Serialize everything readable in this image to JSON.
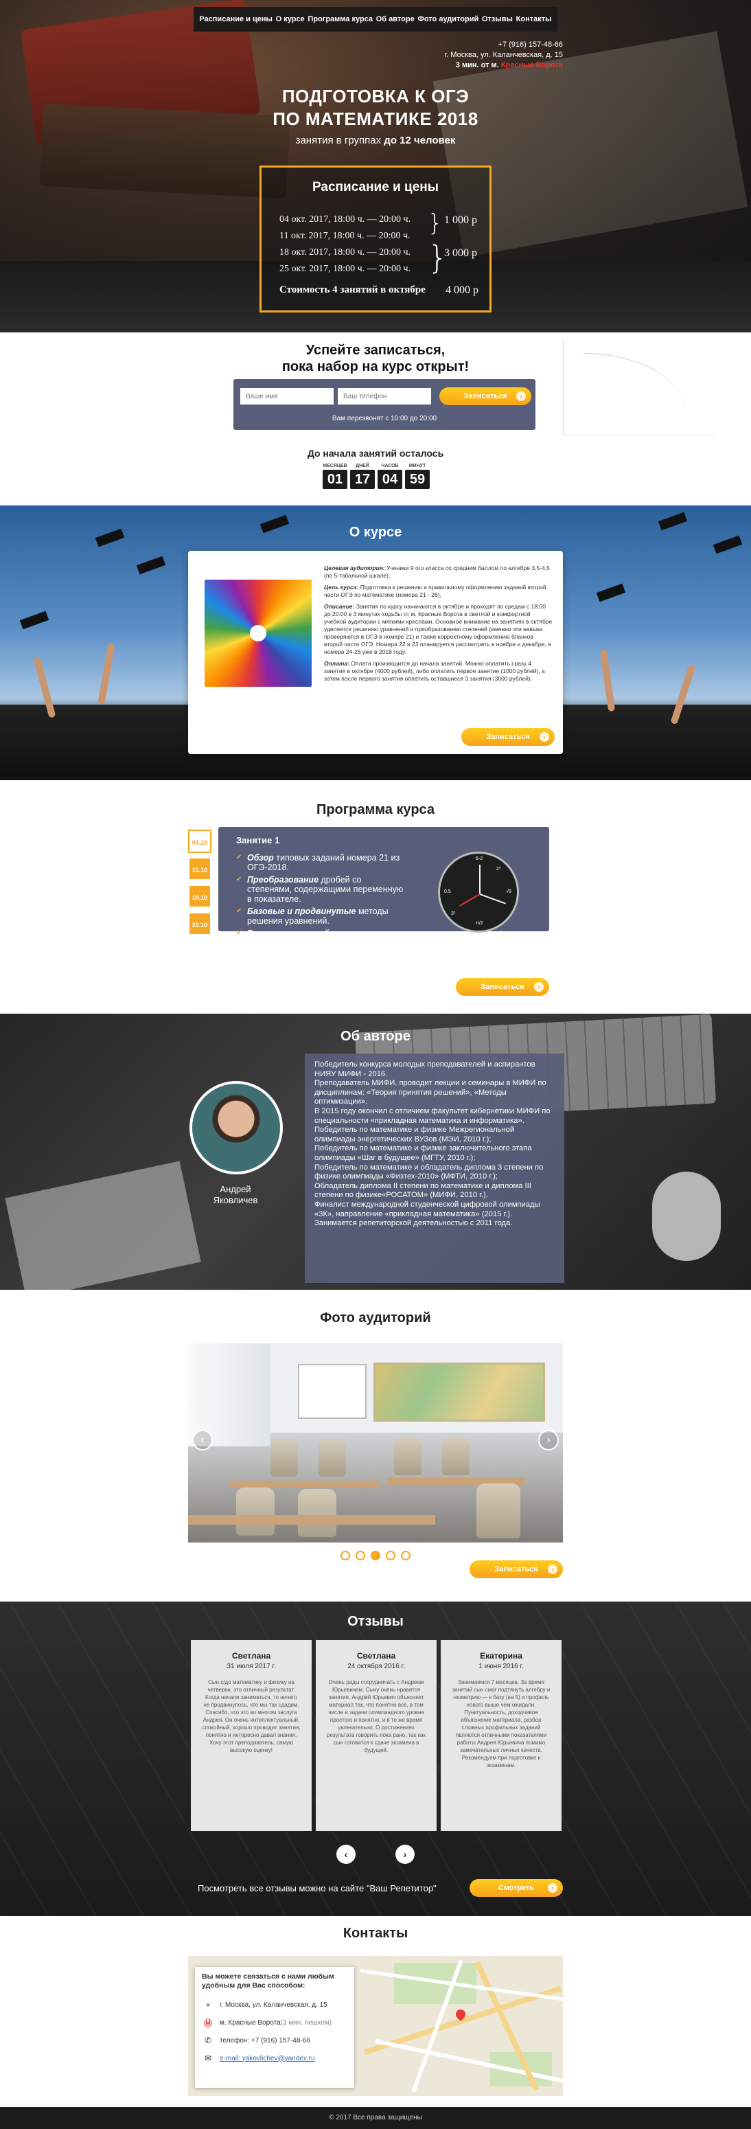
{
  "nav": {
    "items": [
      "Расписание и цены",
      "О курсе",
      "Программа курса",
      "Об авторе",
      "Фото аудиторий",
      "Отзывы",
      "Контакты"
    ]
  },
  "contact_top": {
    "phone": "+7 (916) 157-48-66",
    "address": "г. Москва, ул. Каланчевская, д. 15",
    "walk": "3 мин. от м.",
    "metro": "Красные Ворота"
  },
  "hero": {
    "title_line1": "ПОДГОТОВКА К ОГЭ",
    "title_line2": "ПО МАТЕМАТИКЕ 2018",
    "subtitle_prefix": "занятия в группах",
    "subtitle_bold": "до 12 человек"
  },
  "schedule": {
    "title": "Расписание и цены",
    "rows": [
      "04 окт. 2017, 18:00 ч. — 20:00 ч.",
      "11 окт. 2017, 18:00 ч. — 20:00 ч.",
      "18 окт. 2017, 18:00 ч. — 20:00 ч.",
      "25 окт. 2017, 18:00 ч. — 20:00 ч."
    ],
    "price1": "1 000 р",
    "price2": "3 000 р",
    "total_label": "Стоимость 4 занятий в октябре",
    "total_price": "4 000 р"
  },
  "signup": {
    "title_line1": "Успейте записаться,",
    "title_line2": "пока набор на курс открыт!",
    "name_placeholder": "Ваше имя",
    "phone_placeholder": "Ваш телефон",
    "button": "Записаться",
    "callback": "Вам перезвонят с 10:00 до 20:00",
    "countdown_title": "До начала занятий осталось",
    "countdown": [
      {
        "label": "МЕСЯЦЕВ",
        "value": "01"
      },
      {
        "label": "ДНЕЙ",
        "value": "17"
      },
      {
        "label": "ЧАСОВ",
        "value": "04"
      },
      {
        "label": "МИНУТ",
        "value": "59"
      }
    ]
  },
  "about": {
    "title": "О курсе",
    "p1_key": "Целевая аудитория:",
    "p1": "Ученики 9 ого класса со средним баллом по алгебре 3,5-4,5 (по 5-табальной шкале).",
    "p2_key": "Цель курса:",
    "p2": "Подготовка к решению и правильному оформлению заданий второй части ОГЭ по математике (номера 21 - 26).",
    "p3_key": "Описание:",
    "p3": "Занятия по курсу начинаются в октябре и проходят по средам с 18:00 до 20:00 в 3 минутах ходьбы от м. Красные Ворота в светлой и комфортной учебной аудитории с мягкими креслами. Основное внимание на занятиях в октябре уделяется решению уравнений и преобразованию степеней (именно эти навыки проверяются в ОГЭ в номере 21) и также корректному оформлению бланков второй части ОГЭ. Номера 22 и 23 планируется рассмотреть в ноябре и декабре, а номера 24-26 уже в 2018 году.",
    "p4_key": "Оплата:",
    "p4": "Оплата производится до начала занятий. Можно оплатить сразу 4 занятия в октябре (4000 рублей), либо оплатить первое занятие (1000 рублей), а затем после первого занятия оплатить оставшиеся 3 занятия (3000 рублей).",
    "button": "Записаться"
  },
  "program": {
    "title": "Программа курса",
    "dates": [
      "04.10",
      "11.10",
      "18.10",
      "25.10"
    ],
    "lesson_title": "Занятие 1",
    "items": [
      {
        "bold": "Обзор",
        "text": " типовых заданий номера 21 из ОГЭ-2018."
      },
      {
        "bold": "Преобразование",
        "text": " дробей со степенями, содержащими переменную в показателе."
      },
      {
        "bold": "Базовые и продвинутые",
        "text": " методы решения уравнений."
      },
      {
        "bold": "Решение",
        "text": " уравнений."
      }
    ],
    "clock_ticks": [
      "6-2",
      "√9",
      "π/2",
      "0.5",
      "2⁰",
      "3²"
    ],
    "button": "Записаться"
  },
  "author": {
    "title": "Об авторе",
    "name_line1": "Андрей",
    "name_line2": "Яковличев",
    "bio": "Победитель конкурса молодых преподавателей и аспирантов НИЯУ МИФИ - 2016.\nПреподаватель МИФИ, проводит лекции и семинары в МИФИ по дисциплинам: «Теория принятия решений», «Методы оптимизации».\nВ 2015 году окончил с отличием факультет кибернетики МИФИ по специальности «прикладная математика и информатика».\nПобедитель по математике и физике Межрегиональной олимпиады энергетических ВУЗов (МЭИ, 2010 г.);\nПобедитель по математике и физике заключительного этапа олимпиады «Шаг в будущее» (МГТУ, 2010 г.);\nПобедитель по математике и обладатель диплома 3 степени по физике олимпиады «Физтех-2010» (МФТИ, 2010 г.);\nОбладатель диплома II степени по математике и диплома III степени по физике«РОСАТОМ» (МИФИ, 2010 г.).\nФиналист международной студенческой цифровой олимпиады «3К», направление «прикладная математика» (2015 г.).\nЗанимается репетиторской деятельностью с 2011 года."
  },
  "photos": {
    "title": "Фото аудиторий",
    "prev": "‹",
    "next": "›",
    "dots": 5,
    "active_dot": 3,
    "button": "Записаться"
  },
  "reviews": {
    "title": "Отзывы",
    "items": [
      {
        "name": "Светлана",
        "date": "31 июля 2017 г.",
        "text": "Сын с/до математику и физику на четверки, это отличный результат. Когда начали заниматься, то ничего не продвинулось, что мы так сдадим. Спасибо, что это во многом заслуга Андрея. Он очень интеллектуальный, спокойный, хорошо проводит занятия, понятно и интересно давал знания. Хочу этот преподаватель, самую высокую оценку!"
      },
      {
        "name": "Светлана",
        "date": "24 октября 2016 г.",
        "text": "Очень рады сотрудничать с Андреем Юрьевичем. Сыну очень нравятся занятия. Андрей Юрьевич объясняет материал так, что понятно всё, в том числе и задачи олимпиадного уровня простого и понятно, и в то же время увлекательно. О достижениях результата говорить пока рано, так как сын готовится к сдаче экзамена в будущей."
      },
      {
        "name": "Екатерина",
        "date": "1 июня 2016 г.",
        "text": "Занимаемся 7 месяцев. За время занятий сын смог подтянуть алгебру и геометрию — к базу (на 5) и профиль нового выше чем ожидали. Пунктуальность, доходчивое объяснение материала, разбор сложных профильных заданий являются отличными показателями работы Андрея Юрьевича помимо замечательных личных качеств. Рекомендуем при подготовке к экзаменам."
      }
    ],
    "prev": "‹",
    "next": "›",
    "more_text": "Посмотреть все отзывы можно на сайте \"Ваш Репетитор\"",
    "button": "Смотреть"
  },
  "contacts": {
    "title": "Контакты",
    "header": "Вы можете связаться с нами любым удобным для Вас способом:",
    "address": "г. Москва, ул. Каланчевская, д. 15",
    "metro": "м. Красные Ворота",
    "metro_note": " (3 мин. пешком)",
    "phone": "телефон: +7 (916) 157-48-66",
    "email": "e-mail: yakovlichev@yandex.ru"
  },
  "footer": {
    "text": "© 2017 Все права защищены"
  },
  "colors": {
    "accent": "#f7a823",
    "panel": "#585e7a",
    "dark": "#1c1c1c"
  }
}
